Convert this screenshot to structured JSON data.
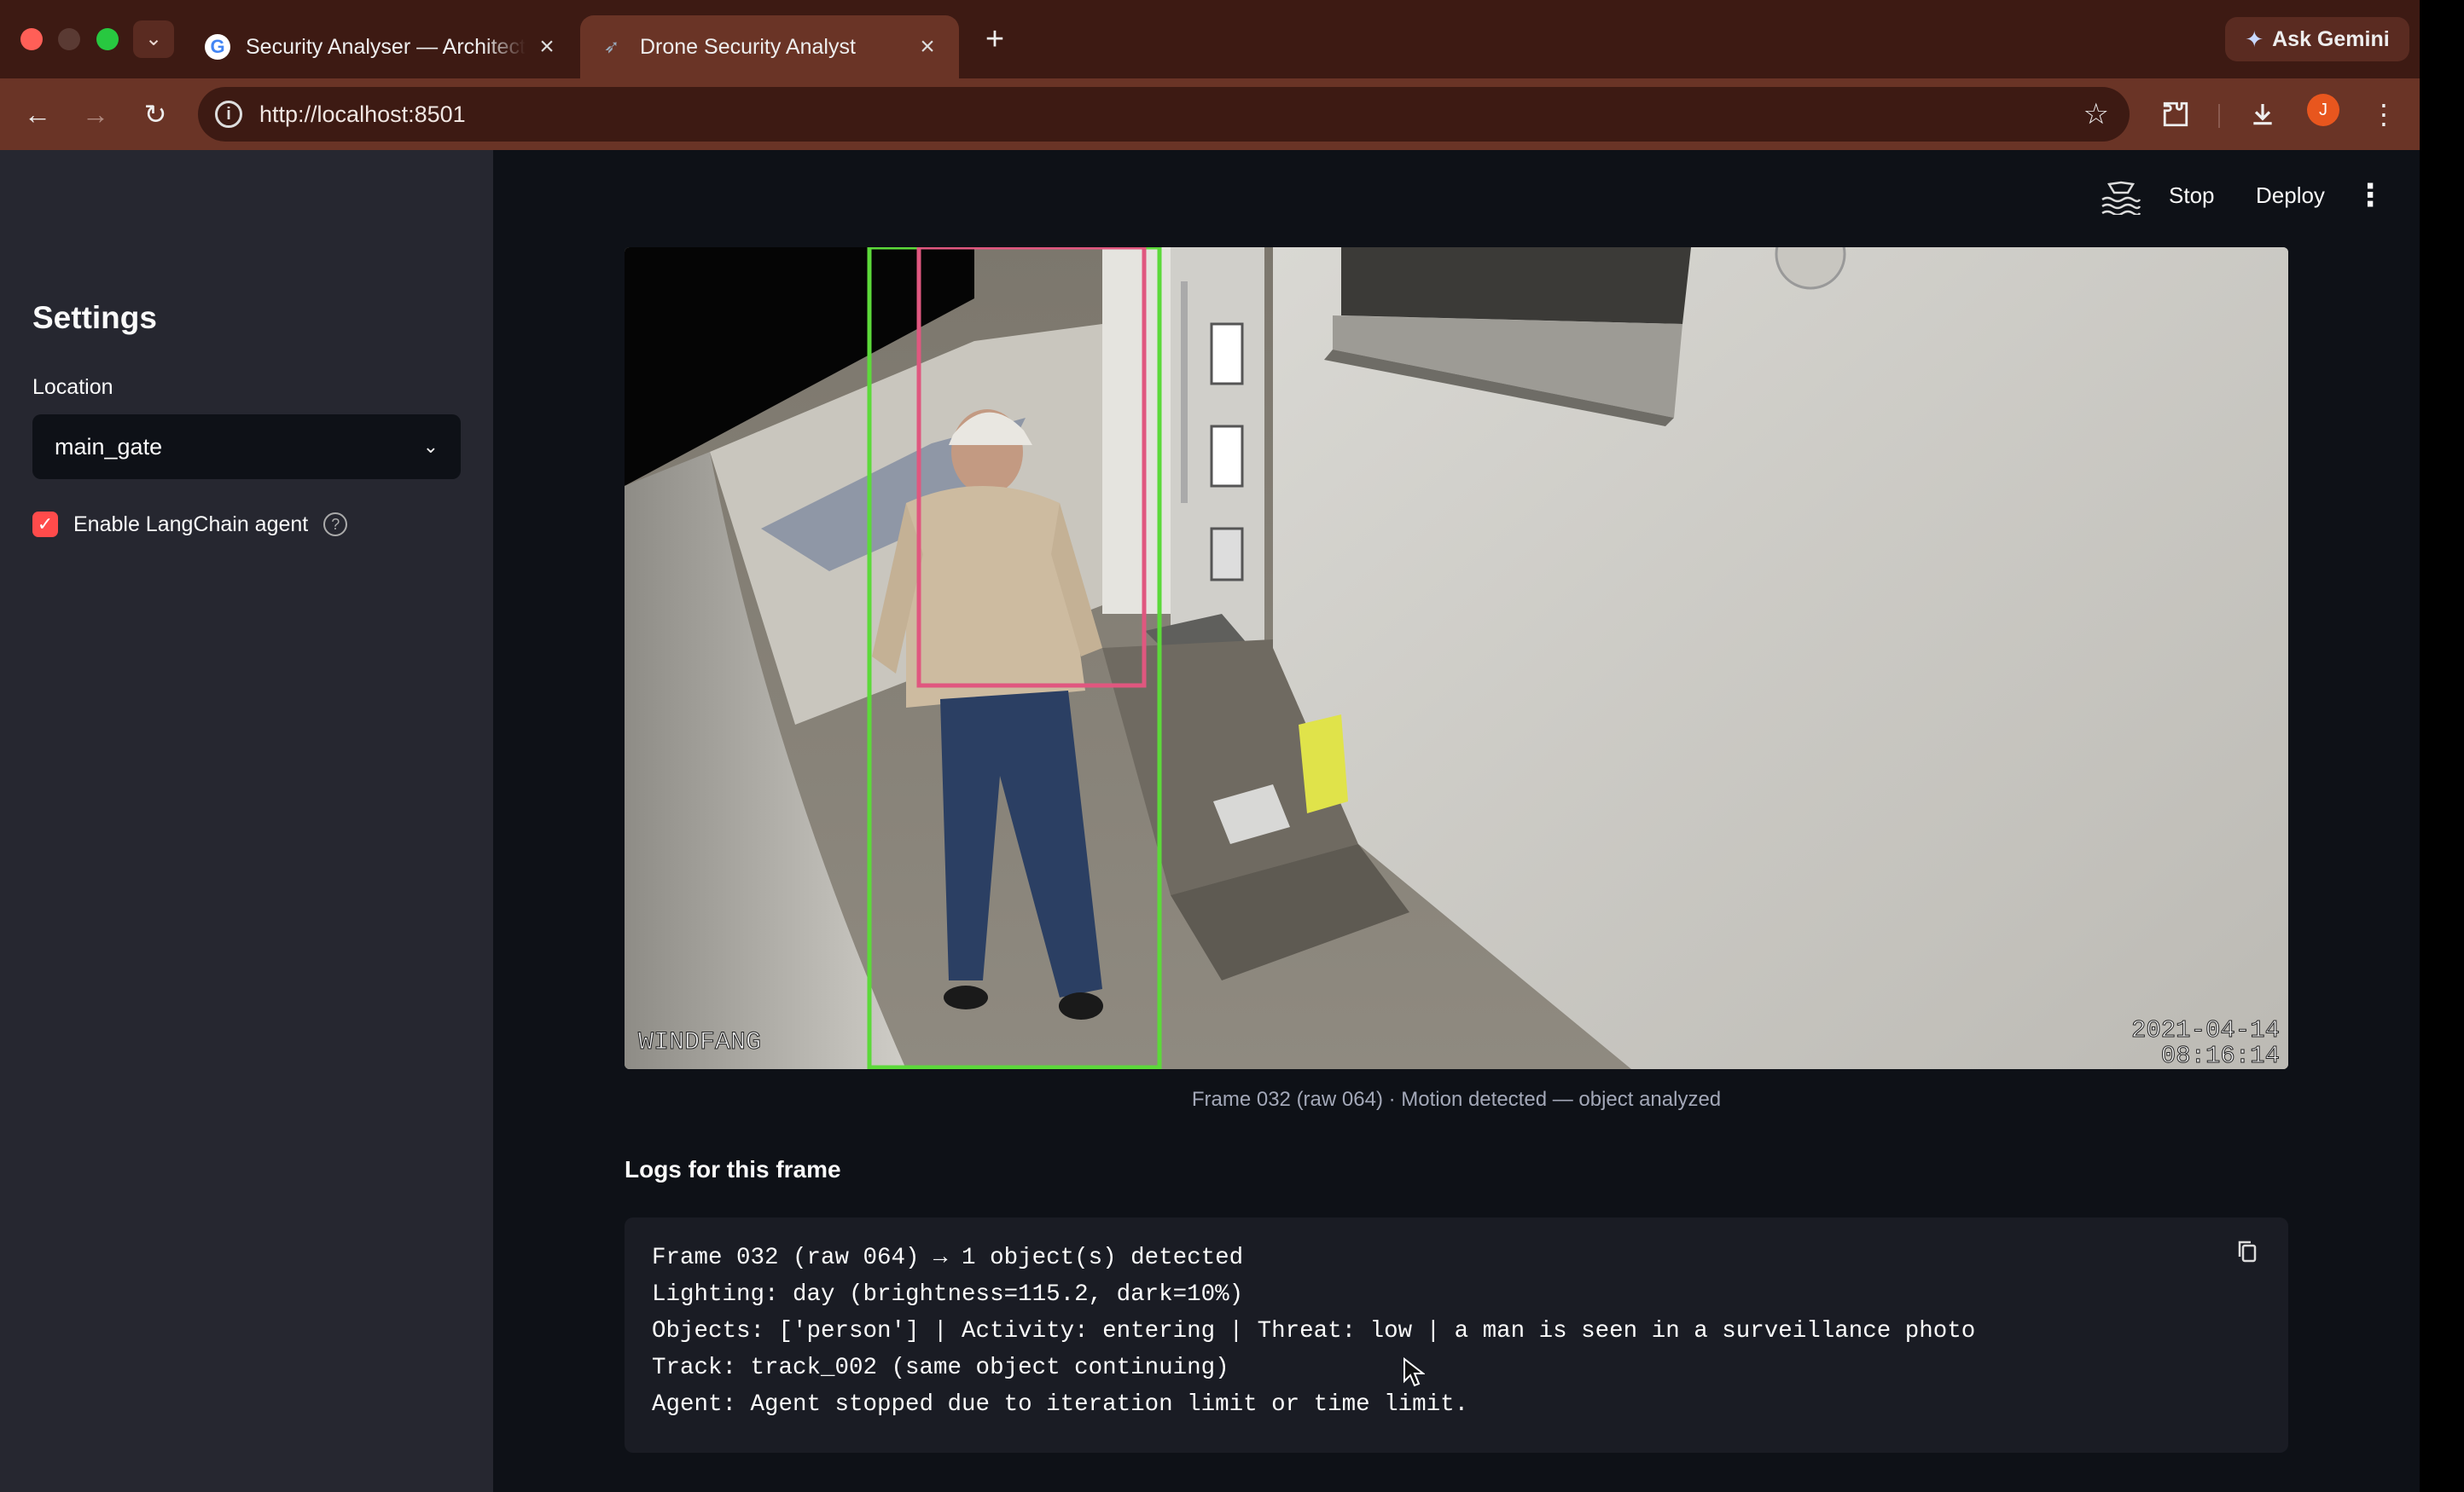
{
  "browser": {
    "tabs": [
      {
        "title": "Security Analyser — Architect",
        "favicon": "google-icon"
      },
      {
        "title": "Drone Security Analyst",
        "favicon": "streamlit-icon",
        "active": true
      }
    ],
    "url": "http://localhost:8501",
    "ask_gemini_label": "Ask Gemini",
    "profile_initial": "J"
  },
  "app": {
    "header": {
      "stop_label": "Stop",
      "deploy_label": "Deploy"
    },
    "sidebar": {
      "title": "Settings",
      "location_label": "Location",
      "location_value": "main_gate",
      "agent_checkbox_label": "Enable LangChain agent",
      "agent_checkbox_checked": true
    },
    "main": {
      "camera": {
        "overlay_label": "WINDFANG",
        "date": "2021-04-14",
        "time": "08:16:14"
      },
      "frame_caption": "Frame 032 (raw 064) · Motion detected — object analyzed",
      "logs_heading": "Logs for this frame",
      "log_lines": [
        "Frame 032 (raw 064) → 1 object(s) detected",
        "Lighting: day (brightness=115.2, dark=10%)",
        "Objects: ['person'] | Activity: entering | Threat: low | a man is seen in a surveillance photo",
        "Track: track_002 (same object continuing)",
        "Agent: Agent stopped due to iteration limit or time limit."
      ]
    }
  },
  "colors": {
    "accent": "#ff4b4b",
    "app_bg": "#0e1117",
    "sidebar_bg": "#262730",
    "box_green": "#5cd93a",
    "box_pink": "#e0577f"
  }
}
